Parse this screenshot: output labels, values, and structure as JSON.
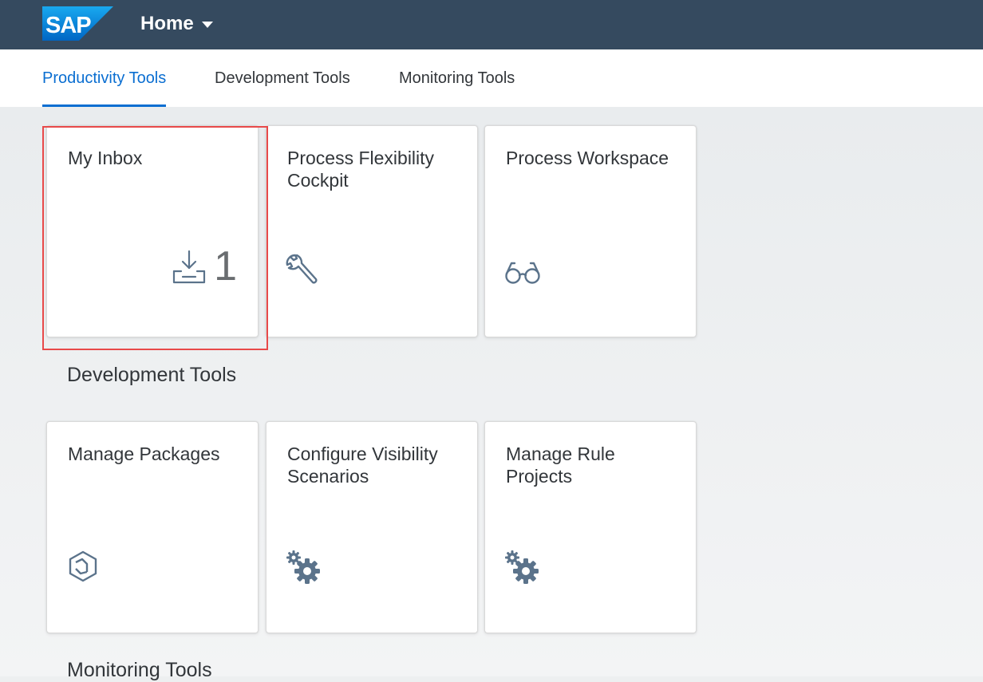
{
  "shell": {
    "logo_text": "SAP",
    "title": "Home",
    "brand_color": "#354a5f"
  },
  "tabs": [
    {
      "label": "Productivity Tools",
      "active": true
    },
    {
      "label": "Development Tools",
      "active": false
    },
    {
      "label": "Monitoring Tools",
      "active": false
    }
  ],
  "groups": {
    "productivity": {
      "tiles": [
        {
          "title": "My Inbox",
          "icon": "inbox-download-icon",
          "kpi": "1"
        },
        {
          "title": "Process Flexibility Cockpit",
          "icon": "wrench-icon"
        },
        {
          "title": "Process Workspace",
          "icon": "glasses-icon"
        }
      ]
    },
    "development": {
      "title": "Development Tools",
      "tiles": [
        {
          "title": "Manage Packages",
          "icon": "package-icon"
        },
        {
          "title": "Configure Visibility Scenarios",
          "icon": "gears-icon"
        },
        {
          "title": "Manage Rule Projects",
          "icon": "gears-icon"
        }
      ]
    },
    "monitoring": {
      "title": "Monitoring Tools"
    }
  },
  "colors": {
    "accent": "#0a6ed1",
    "icon": "#5b738b",
    "highlight": "#e84a4a"
  }
}
